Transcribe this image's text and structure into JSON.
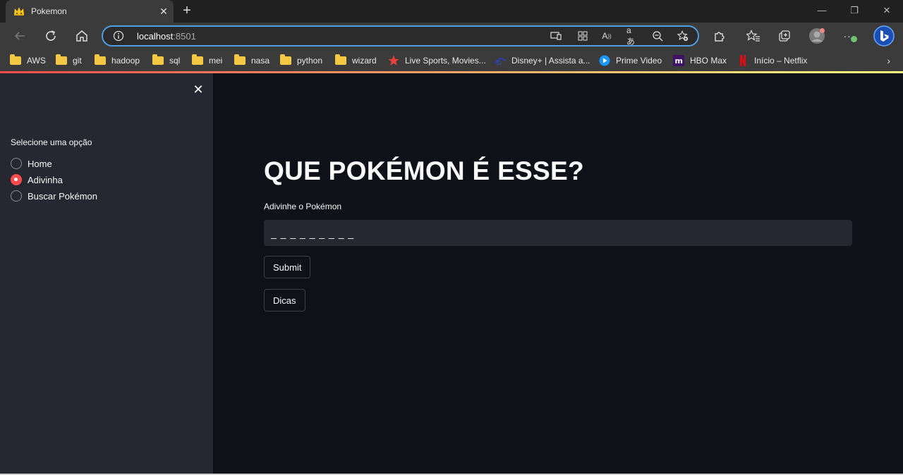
{
  "browser": {
    "tab_title": "Pokemon",
    "address_host": "localhost",
    "address_port": ":8501",
    "bookmarks": [
      {
        "label": "AWS",
        "icon": "folder-icon"
      },
      {
        "label": "git",
        "icon": "folder-icon"
      },
      {
        "label": "hadoop",
        "icon": "folder-icon"
      },
      {
        "label": "sql",
        "icon": "folder-icon"
      },
      {
        "label": "mei",
        "icon": "folder-icon"
      },
      {
        "label": "nasa",
        "icon": "folder-icon"
      },
      {
        "label": "python",
        "icon": "folder-icon"
      },
      {
        "label": "wizard",
        "icon": "folder-icon"
      },
      {
        "label": "Live Sports, Movies...",
        "icon": "star-icon"
      },
      {
        "label": "Disney+ | Assista a...",
        "icon": "disney-icon"
      },
      {
        "label": "Prime Video",
        "icon": "prime-video-icon"
      },
      {
        "label": "HBO Max",
        "icon": "hbo-max-icon"
      },
      {
        "label": "Início – Netflix",
        "icon": "netflix-icon"
      }
    ]
  },
  "sidebar": {
    "label": "Selecione uma opção",
    "options": [
      {
        "label": "Home",
        "selected": false
      },
      {
        "label": "Adivinha",
        "selected": true
      },
      {
        "label": "Buscar Pokémon",
        "selected": false
      }
    ]
  },
  "main": {
    "title": "QUE POKÉMON É ESSE?",
    "input_label": "Adivinhe o Pokémon",
    "input_value": "_ _ _ _ _ _ _ _ _",
    "submit_label": "Submit",
    "hints_label": "Dicas"
  },
  "colors": {
    "accent": "#ff4b4b",
    "background": "#0e1117",
    "sidebar": "#262730"
  }
}
